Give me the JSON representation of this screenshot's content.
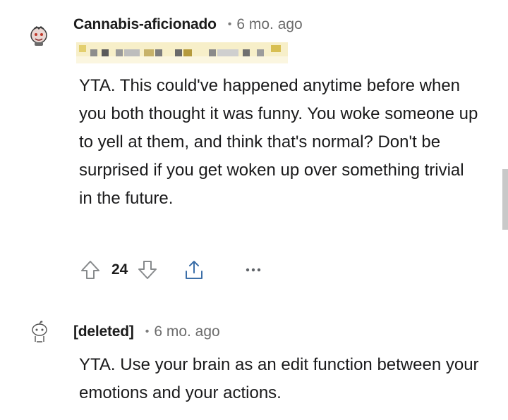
{
  "comments": [
    {
      "username": "Cannabis-aficionado",
      "dot": "•",
      "time": "6 mo. ago",
      "body": "YTA. This could've happened anytime before when you both thought it was funny. You woke someone up to yell at them, and think that's normal? Don't be surprised if you get woken up over something trivial in the future.",
      "score": "24",
      "avatar_icon": "snoo-avatar-icon"
    },
    {
      "username": "[deleted]",
      "dot": "•",
      "time": "6 mo. ago",
      "body": "YTA. Use your brain as an edit function between your emotions and your actions.",
      "avatar_icon": "deleted-snoo-avatar-icon"
    }
  ],
  "icons": {
    "upvote": "upvote-arrow-icon",
    "downvote": "downvote-arrow-icon",
    "share": "share-icon",
    "more": "more-options-icon"
  },
  "colors": {
    "text": "#1a1a1b",
    "meta": "#6c6c6c",
    "flair_tint": "#c9a93a"
  }
}
